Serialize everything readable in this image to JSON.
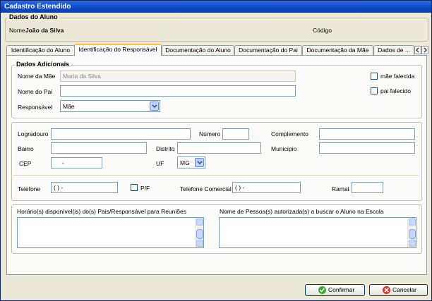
{
  "window": {
    "title": "Cadastro Estendido"
  },
  "aluno": {
    "legend": "Dados do Aluno",
    "nome_label": "Nome",
    "nome_value": "João da Silva",
    "codigo_label": "Código"
  },
  "tabs": [
    {
      "label": "Identificação do Aluno"
    },
    {
      "label": "Identificação do Responsável"
    },
    {
      "label": "Documentação do Aluno"
    },
    {
      "label": "Documentação do Pai"
    },
    {
      "label": "Documentação da Mãe"
    },
    {
      "label": "Dados de ..."
    }
  ],
  "adicionais": {
    "legend": "Dados Adicionais",
    "mae_label": "Nome da Mãe",
    "mae_value": "Maria da Silva",
    "pai_label": "Nome do Pai",
    "pai_value": "",
    "resp_label": "Responsável",
    "resp_value": "Mãe",
    "mae_falecida": "mãe falecida",
    "pai_falecido": "pai falecido"
  },
  "endereco": {
    "logradouro": "Logradouro",
    "numero": "Número",
    "complemento": "Complemento",
    "bairro": "Bairro",
    "distrito": "Distrito",
    "municipio": "Município",
    "cep": "CEP",
    "cep_value": "-",
    "uf": "UF",
    "uf_value": "MG"
  },
  "contato": {
    "telefone": "Telefone",
    "telefone_value": "(  )     -",
    "pf": "P/F",
    "tel_comercial": "Telefone Comercial",
    "tel_comercial_value": "(  )     -",
    "ramal": "Ramal"
  },
  "memos": {
    "horario": "Horário(s) disponível(is) do(s) Pais/Responsável para Reuniões",
    "pessoas": "Nome de Pessoa(s) autorizada(s) a buscar o Aluno na Escola"
  },
  "buttons": {
    "confirmar": "Confirmar",
    "cancelar": "Cancelar"
  },
  "colors": {
    "title_bar": "#0a46c8",
    "confirm_icon": "#3fa535",
    "cancel_icon": "#d9352a",
    "active_tab_accent": "#ffc83c"
  }
}
